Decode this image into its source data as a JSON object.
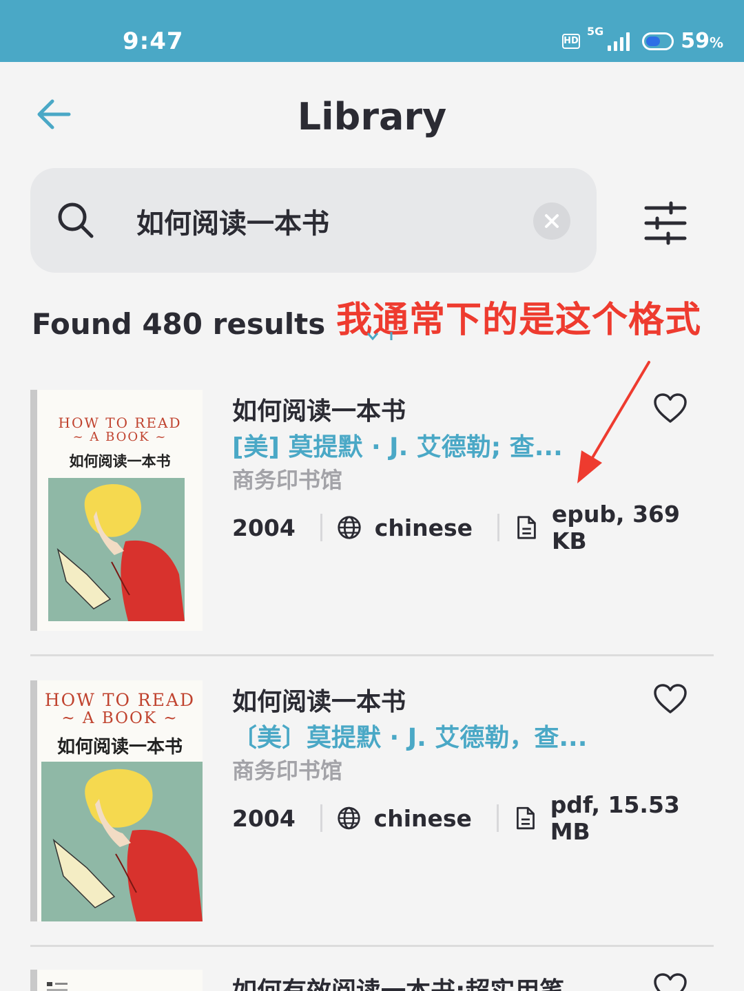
{
  "status_bar": {
    "time": "9:47",
    "hd": "HD",
    "network": "5G",
    "battery_percent": "59",
    "battery_unit": "%",
    "battery_level": 0.59
  },
  "header": {
    "title": "Library",
    "back_icon": "arrow-left-icon"
  },
  "search": {
    "query": "如何阅读一本书",
    "search_icon": "search-icon",
    "clear_icon": "close-icon",
    "filter_icon": "sliders-icon"
  },
  "results": {
    "count_text": "Found 480 results"
  },
  "annotation": {
    "text": "我通常下的是这个格式",
    "color": "#ee3b2f"
  },
  "books": [
    {
      "title": "如何阅读一本书",
      "author": "[美] 莫提默 · J. 艾德勒; 查...",
      "publisher": "商务印书馆",
      "year": "2004",
      "language": "chinese",
      "file": "epub, 369 KB",
      "cover": {
        "line1": "HOW TO READ",
        "line2": "~ A BOOK ~",
        "title": "如何阅读一本书"
      }
    },
    {
      "title": "如何阅读一本书",
      "author": "〔美〕莫提默 · J. 艾德勒，查...",
      "publisher": "商务印书馆",
      "year": "2004",
      "language": "chinese",
      "file": "pdf, 15.53 MB",
      "cover": {
        "line1": "HOW TO READ",
        "line2": "~ A BOOK ~",
        "title": "如何阅读一本书"
      }
    },
    {
      "title": "如何有效阅读一本书:超实用笔"
    }
  ],
  "colors": {
    "accent": "#4aa8c6",
    "title_text": "#2b2b33",
    "muted_text": "#a3a3a8",
    "background": "#f4f4f4"
  }
}
